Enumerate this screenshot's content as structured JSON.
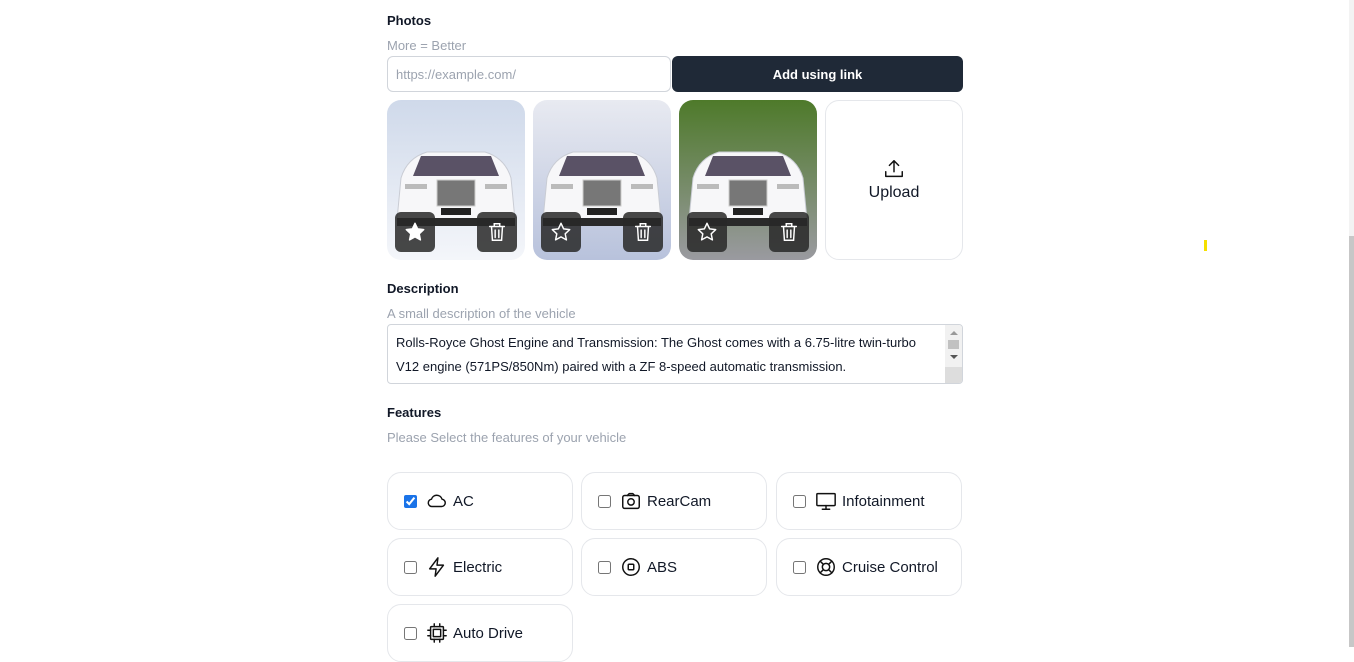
{
  "photos": {
    "title": "Photos",
    "hint": "More = Better",
    "url_placeholder": "https://example.com/",
    "url_value": "",
    "add_button": "Add using link",
    "upload_label": "Upload",
    "images": [
      {
        "featured": true,
        "bg": [
          "#cfd9ea",
          "#f4f6fa"
        ]
      },
      {
        "featured": false,
        "bg": [
          "#e8eaf1",
          "#b8c2dc"
        ]
      },
      {
        "featured": false,
        "bg": [
          "#4e7a2a",
          "#9a9aa0"
        ]
      }
    ]
  },
  "description": {
    "title": "Description",
    "hint": "A small description of the vehicle",
    "value": "Rolls-Royce Ghost Engine and Transmission: The Ghost comes with a 6.75-litre twin-turbo V12 engine (571PS/850Nm) paired with a ZF 8-speed automatic transmission."
  },
  "features": {
    "title": "Features",
    "hint": "Please Select the features of your vehicle",
    "items": [
      {
        "label": "AC",
        "icon": "cloud-icon",
        "checked": true
      },
      {
        "label": "RearCam",
        "icon": "camera-icon",
        "checked": false
      },
      {
        "label": "Infotainment",
        "icon": "monitor-icon",
        "checked": false
      },
      {
        "label": "Electric",
        "icon": "bolt-icon",
        "checked": false
      },
      {
        "label": "ABS",
        "icon": "stop-circle-icon",
        "checked": false
      },
      {
        "label": "Cruise Control",
        "icon": "lifebuoy-icon",
        "checked": false
      },
      {
        "label": "Auto Drive",
        "icon": "cpu-icon",
        "checked": false
      }
    ]
  },
  "colors": {
    "primary": "#1f2937",
    "checkbox": "#1a73e8",
    "muted": "#9ca3af"
  }
}
